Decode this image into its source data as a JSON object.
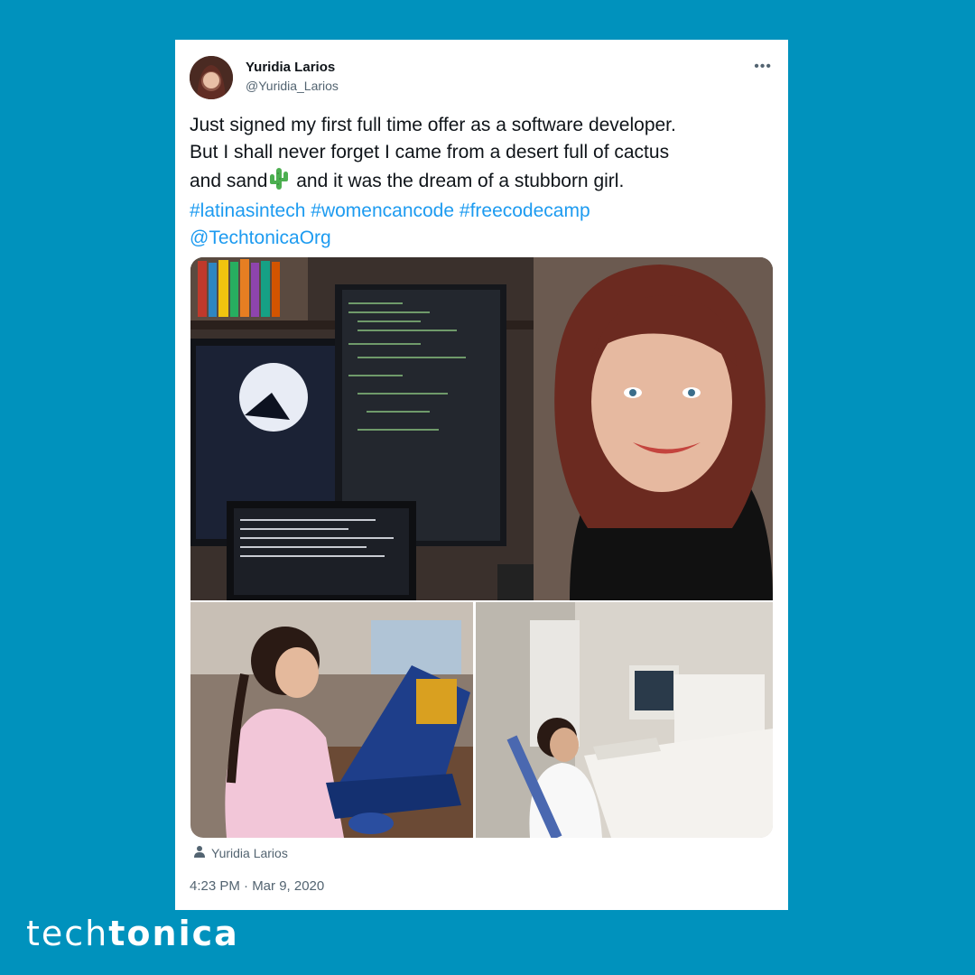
{
  "tweet": {
    "author_name": "Yuridia Larios",
    "author_handle": "@Yuridia_Larios",
    "more_icon": "more-icon",
    "text_line1": "Just signed my first full time offer as a software developer.",
    "text_line2": "But I shall never forget I came from a desert full of cactus",
    "text_line3a": "and sand",
    "text_line3b": " and it was the dream of a stubborn girl.",
    "hashtags": [
      "#latinasintech",
      "#womencancode",
      "#freecodecamp"
    ],
    "mention": "@TechtonicaOrg",
    "media_credit": "Yuridia Larios",
    "timestamp": "4:23 PM · Mar 9, 2020"
  },
  "brand": {
    "part1": "tech",
    "part2": "tonica"
  },
  "colors": {
    "background": "#0092bd",
    "link": "#1d9bf0",
    "text": "#0f1419",
    "muted": "#536471"
  }
}
